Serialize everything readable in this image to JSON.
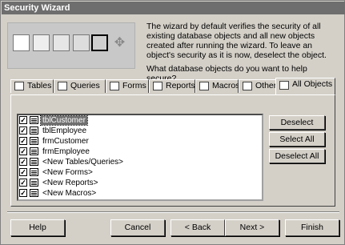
{
  "window": {
    "title": "Security Wizard"
  },
  "banner": {
    "icons": [
      "table-icon",
      "query-icon",
      "form-icon",
      "report-icon",
      "macro-icon",
      "module-icon"
    ]
  },
  "description": "The wizard by default verifies the security of all existing database objects and all new objects created after running the wizard. To leave an object's security as it is now, deselect the object.",
  "question": "What database objects do you want to help secure?",
  "tabs": [
    {
      "label": "Tables",
      "icon": "table-icon"
    },
    {
      "label": "Queries",
      "icon": "query-icon"
    },
    {
      "label": "Forms",
      "icon": "form-icon"
    },
    {
      "label": "Reports",
      "icon": "report-icon"
    },
    {
      "label": "Macros",
      "icon": "macro-icon"
    },
    {
      "label": "Other",
      "icon": "other-icon"
    },
    {
      "label": "All Objects",
      "icon": "all-objects-icon"
    }
  ],
  "objects": [
    {
      "label": "tblCustomer",
      "checked": true,
      "selected": true,
      "icon": "table-icon"
    },
    {
      "label": "tblEmployee",
      "checked": true,
      "icon": "table-icon"
    },
    {
      "label": "frmCustomer",
      "checked": true,
      "icon": "form-icon"
    },
    {
      "label": "frmEmployee",
      "checked": true,
      "icon": "form-icon"
    },
    {
      "label": "<New Tables/Queries>",
      "checked": true,
      "icon": "table-icon"
    },
    {
      "label": "<New Forms>",
      "checked": true,
      "icon": "form-icon"
    },
    {
      "label": "<New Reports>",
      "checked": true,
      "icon": "report-icon"
    },
    {
      "label": "<New Macros>",
      "checked": true,
      "icon": "macro-icon"
    }
  ],
  "buttons": {
    "deselect": "Deselect",
    "select_all": "Select All",
    "deselect_all": "Deselect All",
    "help": "Help",
    "cancel": "Cancel",
    "back": "< Back",
    "next": "Next >",
    "finish": "Finish"
  },
  "colors": {
    "title_bar": "#6e6e6e",
    "selection": "#707070",
    "face": "#d4d0c8"
  }
}
